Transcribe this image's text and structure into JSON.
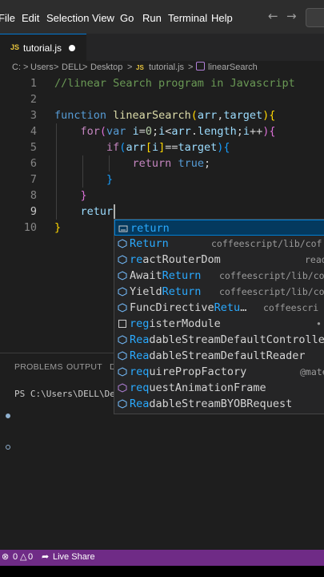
{
  "menubar": {
    "items": [
      "File",
      "Edit",
      "Selection",
      "View",
      "Go",
      "Run",
      "Terminal",
      "Help"
    ],
    "back_icon": "arrow-left-icon",
    "forward_icon": "arrow-right-icon"
  },
  "tab": {
    "badge": "JS",
    "name": "tutorial.js",
    "modified_icon": "dirty-dot-icon"
  },
  "breadcrumb": {
    "segments": [
      "C:",
      "Users",
      "DELL",
      "Desktop",
      "tutorial.js",
      "linearSearch"
    ],
    "separator": ">",
    "file_badge": "JS"
  },
  "editor": {
    "line_numbers": [
      "1",
      "2",
      "3",
      "4",
      "5",
      "6",
      "7",
      "8",
      "9",
      "10"
    ],
    "active_line": 9,
    "colors": {
      "keyword": "#569cd6",
      "control": "#c586c0",
      "function": "#dcdcaa",
      "variable": "#9cdcfe",
      "number": "#b5cea8",
      "comment": "#6a9955"
    }
  },
  "suggest": {
    "items": [
      {
        "pre": "",
        "match": "return",
        "post": "",
        "detail": "",
        "icon": "keyword-icon"
      },
      {
        "pre": "",
        "match": "Return",
        "post": "",
        "detail": "coffeescript/lib/cof",
        "icon": "module-icon"
      },
      {
        "pre": "",
        "match": "re",
        "post": "actRouterDom",
        "detail": "read",
        "icon": "module-icon"
      },
      {
        "pre": "Await",
        "match": "Return",
        "post": "",
        "detail": "coffeescript/lib/co",
        "icon": "module-icon"
      },
      {
        "pre": "Yield",
        "match": "Return",
        "post": "",
        "detail": "coffeescript/lib/co",
        "icon": "module-icon"
      },
      {
        "pre": "FuncDirective",
        "match": "Retu",
        "post": "…",
        "detail": "coffeescri",
        "icon": "module-icon"
      },
      {
        "pre": "",
        "match": "reg",
        "post": "isterModule",
        "detail": "",
        "icon": "snippet-icon"
      },
      {
        "pre": "",
        "match": "Rea",
        "post": "dableStreamDefaultControlle",
        "detail": "",
        "icon": "module-icon"
      },
      {
        "pre": "",
        "match": "Rea",
        "post": "dableStreamDefaultReader",
        "detail": "",
        "icon": "module-icon"
      },
      {
        "pre": "",
        "match": "req",
        "post": "uirePropFactory",
        "detail": "@mate",
        "icon": "module-icon"
      },
      {
        "pre": "",
        "match": "req",
        "post": "uestAnimationFrame",
        "detail": "",
        "icon": "method-icon"
      },
      {
        "pre": "",
        "match": "Rea",
        "post": "dableStreamBYOBRequest",
        "detail": "",
        "icon": "module-icon"
      }
    ]
  },
  "panel": {
    "tabs": [
      "PROBLEMS",
      "OUTPUT",
      "D"
    ],
    "terminal_prompt": "PS C:\\Users\\DELL\\Deskt"
  },
  "statusbar": {
    "errors": "0",
    "warnings": "0",
    "liveshare": "Live Share",
    "color": "#6f2b86"
  }
}
